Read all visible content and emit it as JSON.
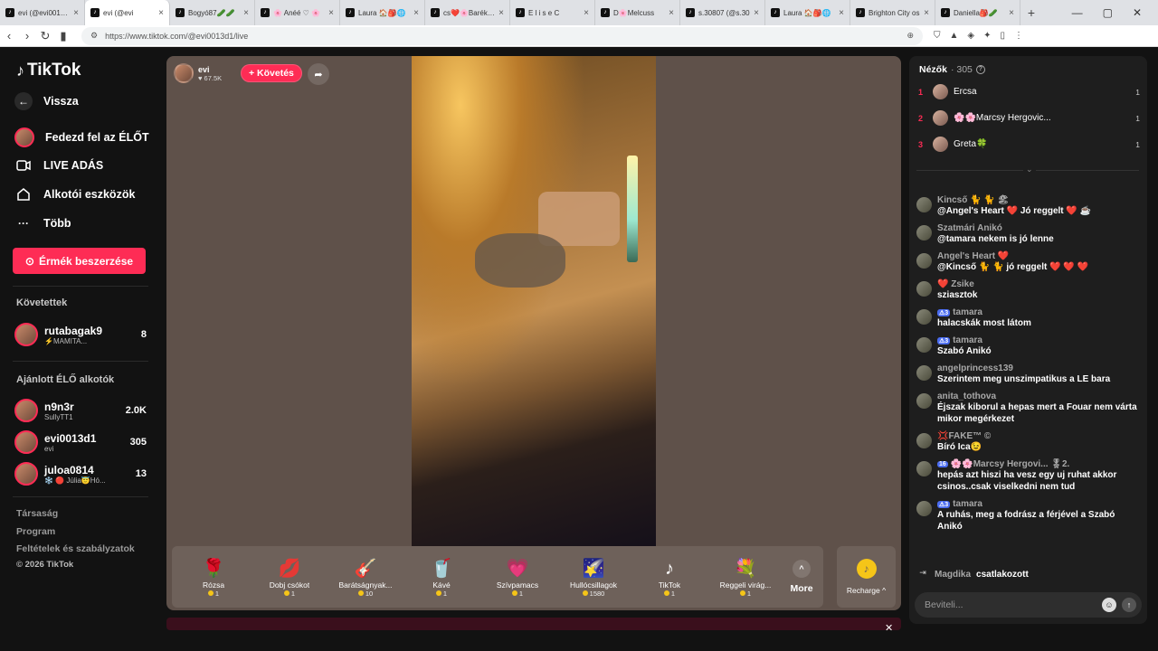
{
  "browser": {
    "tabs": [
      {
        "label": "evi (@evi0013d1)",
        "active": false
      },
      {
        "label": "evi (@evi",
        "active": true
      },
      {
        "label": "Bogyó87🥒🥒",
        "active": false
      },
      {
        "label": "🌸 Anéé ♡ 🌸",
        "active": false
      },
      {
        "label": "Laura 🏠🎒🌐",
        "active": false
      },
      {
        "label": "cs❤️🌸Barékai🌸",
        "active": false
      },
      {
        "label": "E l i s e C",
        "active": false
      },
      {
        "label": "D🌸Melcuss",
        "active": false
      },
      {
        "label": "s.30807 (@s.30",
        "active": false
      },
      {
        "label": "Laura 🏠🎒🌐",
        "active": false
      },
      {
        "label": "Brighton City os",
        "active": false
      },
      {
        "label": "Daniella🎒🥒",
        "active": false
      }
    ],
    "url": "https://www.tiktok.com/@evi0013d1/live"
  },
  "sidebar": {
    "brand": "TikTok",
    "back": "Vissza",
    "nav": [
      {
        "label": "Fedezd fel az ÉLŐT",
        "icon": "avatar-icon"
      },
      {
        "label": "LIVE ADÁS",
        "icon": "camera-icon"
      },
      {
        "label": "Alkotói eszközök",
        "icon": "creator-tools-icon"
      },
      {
        "label": "Több",
        "icon": "more-icon"
      }
    ],
    "coins_button": "Érmék beszerzése",
    "following_title": "Követettek",
    "following": [
      {
        "name": "rutabagak9",
        "sub": "⚡MAMITA...",
        "count": "8"
      }
    ],
    "suggested_title": "Ajánlott ÉLŐ alkotók",
    "suggested": [
      {
        "name": "n9n3r",
        "sub": "SullyTT1",
        "count": "2.0K"
      },
      {
        "name": "evi0013d1",
        "sub": "evi",
        "count": "305"
      },
      {
        "name": "juloa0814",
        "sub": "❄️ 🔴 Júlia😇Hó...",
        "count": "13"
      }
    ],
    "footer": [
      "Társaság",
      "Program",
      "Feltételek és szabályzatok",
      "© 2026 TikTok"
    ]
  },
  "player": {
    "host_name": "evi",
    "host_likes": "67.5K",
    "follow_label": "+ Követés",
    "gifts": [
      {
        "name": "Rózsa",
        "price": "1",
        "icon": "🌹"
      },
      {
        "name": "Dobj csókot",
        "price": "1",
        "icon": "💋"
      },
      {
        "name": "Barátságnyak...",
        "price": "10",
        "icon": "🎸"
      },
      {
        "name": "Kávé",
        "price": "1",
        "icon": "🥤"
      },
      {
        "name": "Szívpamacs",
        "price": "1",
        "icon": "💗"
      },
      {
        "name": "Hullócsillagok",
        "price": "1580",
        "icon": "🌠"
      },
      {
        "name": "TikTok",
        "price": "1",
        "icon": "♪"
      },
      {
        "name": "Reggeli virág...",
        "price": "1",
        "icon": "💐"
      }
    ],
    "more_label": "More",
    "recharge_label": "Recharge ^"
  },
  "chat": {
    "viewers_title": "Nézők",
    "viewers_count": "· 305",
    "top_viewers": [
      {
        "rank": "1",
        "name": "Ercsa",
        "count": "1"
      },
      {
        "rank": "2",
        "name": "🌸🌸Marcsy Hergovic...",
        "count": "1"
      },
      {
        "rank": "3",
        "name": "Greta🍀",
        "count": "1"
      }
    ],
    "messages": [
      {
        "user": "Kincső 🐈 🐈 🏖",
        "badge": "",
        "text": "@Angel's Heart ❤️ Jó reggelt ❤️ ☕"
      },
      {
        "user": "Szatmári Anikó",
        "badge": "",
        "text": "@tamara nekem is jó lenne"
      },
      {
        "user": "Angel's Heart ❤️",
        "badge": "",
        "text": "@Kincső 🐈 🐈 jó reggelt ❤️ ❤️ ❤️"
      },
      {
        "user": "❤️ Zsike",
        "badge": "",
        "text": "sziasztok"
      },
      {
        "user": "tamara",
        "badge": "⚠3",
        "text": "halacskák most látom"
      },
      {
        "user": "tamara",
        "badge": "⚠3",
        "text": "Szabó Anikó"
      },
      {
        "user": "angelprincess139",
        "badge": "",
        "text": "Szerintem meg unszimpatikus a LE bara"
      },
      {
        "user": "anita_tothova",
        "badge": "",
        "text": "Éjszak kiborul a hepas mert a Fouar nem várta mikor megérkezet"
      },
      {
        "user": "💢FAKE™ ©",
        "badge": "",
        "text": "Bíró Ica😉"
      },
      {
        "user": "🌸🌸Marcsy Hergovi... 🎖2.",
        "badge": "16",
        "text": "hepás azt hiszi ha vesz egy uj ruhat akkor csinos..csak viselkedni nem tud"
      },
      {
        "user": "tamara",
        "badge": "⚠3",
        "text": "A ruhás, meg a fodrász a férjével a Szabó Anikó"
      }
    ],
    "joined_user": "Magdika",
    "joined_action": "csatlakozott",
    "input_placeholder": "Beviteli..."
  }
}
